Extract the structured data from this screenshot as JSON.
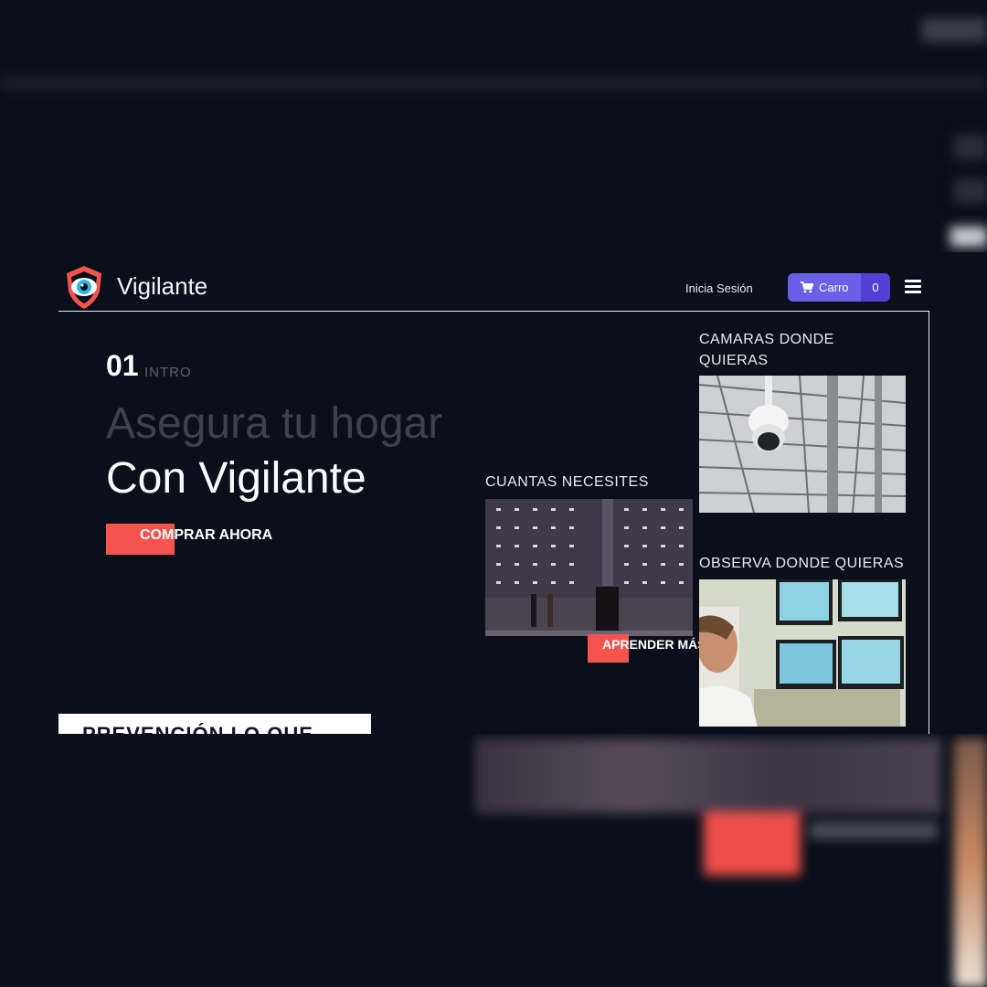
{
  "brand": {
    "name": "Vigilante",
    "accent": "#f4544d",
    "logo_icon": "eye-shield-icon"
  },
  "nav": {
    "login_label": "Inicia Sesión",
    "cart_label": "Carro",
    "cart_count": "0",
    "cart_icon": "shopping-cart-icon",
    "menu_icon": "hamburger-menu-icon",
    "cart_color": "#6b5fe8",
    "cart_count_color": "#5140d6"
  },
  "hero": {
    "number": "01",
    "section_label": "INTRO",
    "headline_faded": "Asegura tu hogar",
    "headline_main": "Con Vigilante",
    "cta_label": "COMPRAR AHORA"
  },
  "gallery": {
    "item1_caption": "CAMARAS DONDE QUIERAS",
    "item2_caption": "CUANTAS NECESITES",
    "item2_button": "APRENDER MÁS",
    "item3_caption": "OBSERVA DONDE QUIERAS"
  },
  "next_section": {
    "title": "PREVENCIÓN LO QUE"
  }
}
